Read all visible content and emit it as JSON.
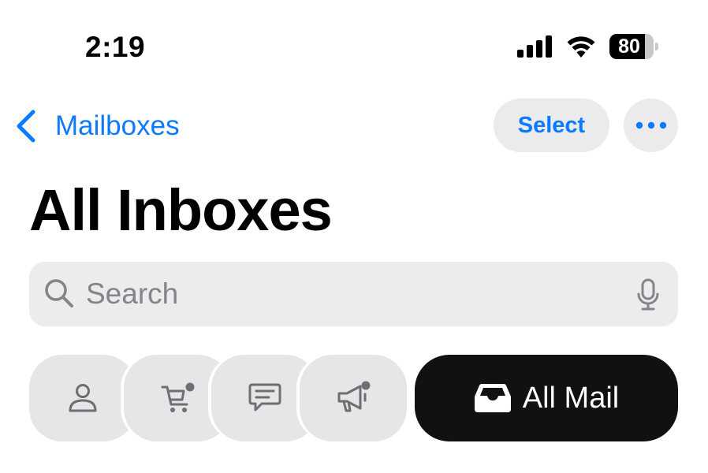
{
  "status_bar": {
    "time": "2:19",
    "battery_percent": "80",
    "battery_level": 0.8
  },
  "nav": {
    "back_label": "Mailboxes",
    "select_label": "Select",
    "accent_color": "#0a7aff"
  },
  "page": {
    "title": "All Inboxes"
  },
  "search": {
    "placeholder": "Search"
  },
  "categories": [
    {
      "icon": "person-icon",
      "badge": false
    },
    {
      "icon": "cart-icon",
      "badge": true
    },
    {
      "icon": "message-icon",
      "badge": false
    },
    {
      "icon": "megaphone-icon",
      "badge": true
    }
  ],
  "all_mail": {
    "label": "All Mail",
    "icon": "tray-icon",
    "selected": true
  }
}
